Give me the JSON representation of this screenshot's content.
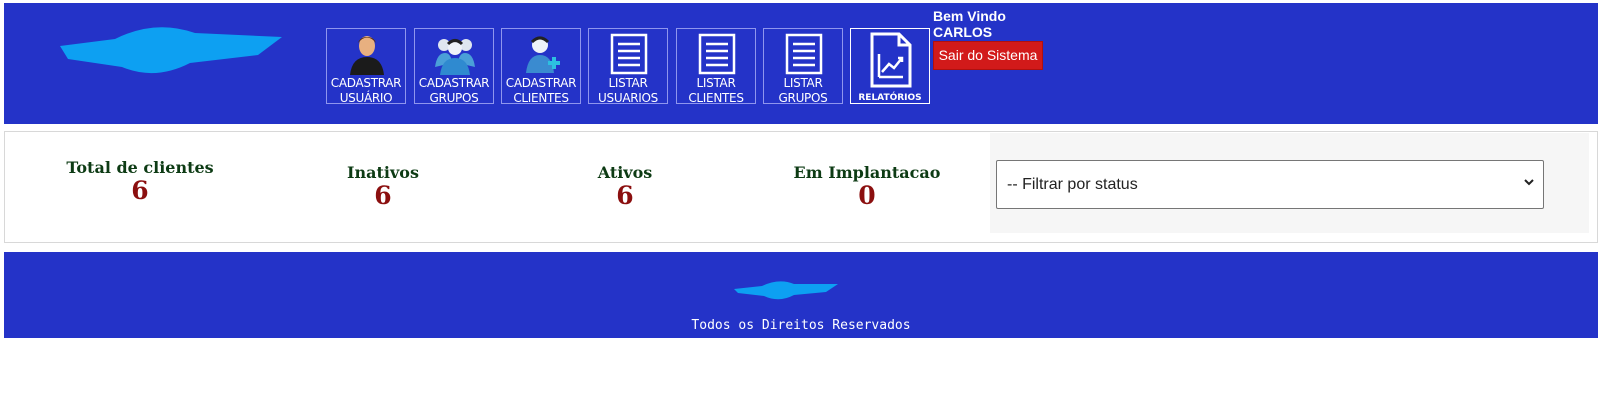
{
  "header": {
    "nav": [
      {
        "label": "CADASTRAR USUÁRIO",
        "icon": "user-icon"
      },
      {
        "label": "CADASTRAR GRUPOS",
        "icon": "group-icon"
      },
      {
        "label": "CADASTRAR CLIENTES",
        "icon": "add-client-icon"
      },
      {
        "label": "LISTAR USUARIOS",
        "icon": "list-document-icon"
      },
      {
        "label": "LISTAR CLIENTES",
        "icon": "list-document-icon"
      },
      {
        "label": "LISTAR GRUPOS",
        "icon": "list-document-icon"
      },
      {
        "label": "RELATÓRIOS",
        "icon": "report-chart-icon"
      }
    ],
    "welcome_line": "Bem Vindo",
    "user_name": "CARLOS",
    "logout_label": "Sair do Sistema"
  },
  "stats": [
    {
      "label": "Total de clientes",
      "value": "6"
    },
    {
      "label": "Inativos",
      "value": "6"
    },
    {
      "label": "Ativos",
      "value": "6"
    },
    {
      "label": "Em Implantacao",
      "value": "0"
    }
  ],
  "filter": {
    "selected": "-- Filtrar por status"
  },
  "footer": {
    "text": "Todos os Direitos Reservados"
  },
  "colors": {
    "brand_blue": "#2433c8",
    "logout_red": "#d21a1a",
    "stat_value": "#8b0f0f",
    "stat_label": "#0d3b14"
  }
}
